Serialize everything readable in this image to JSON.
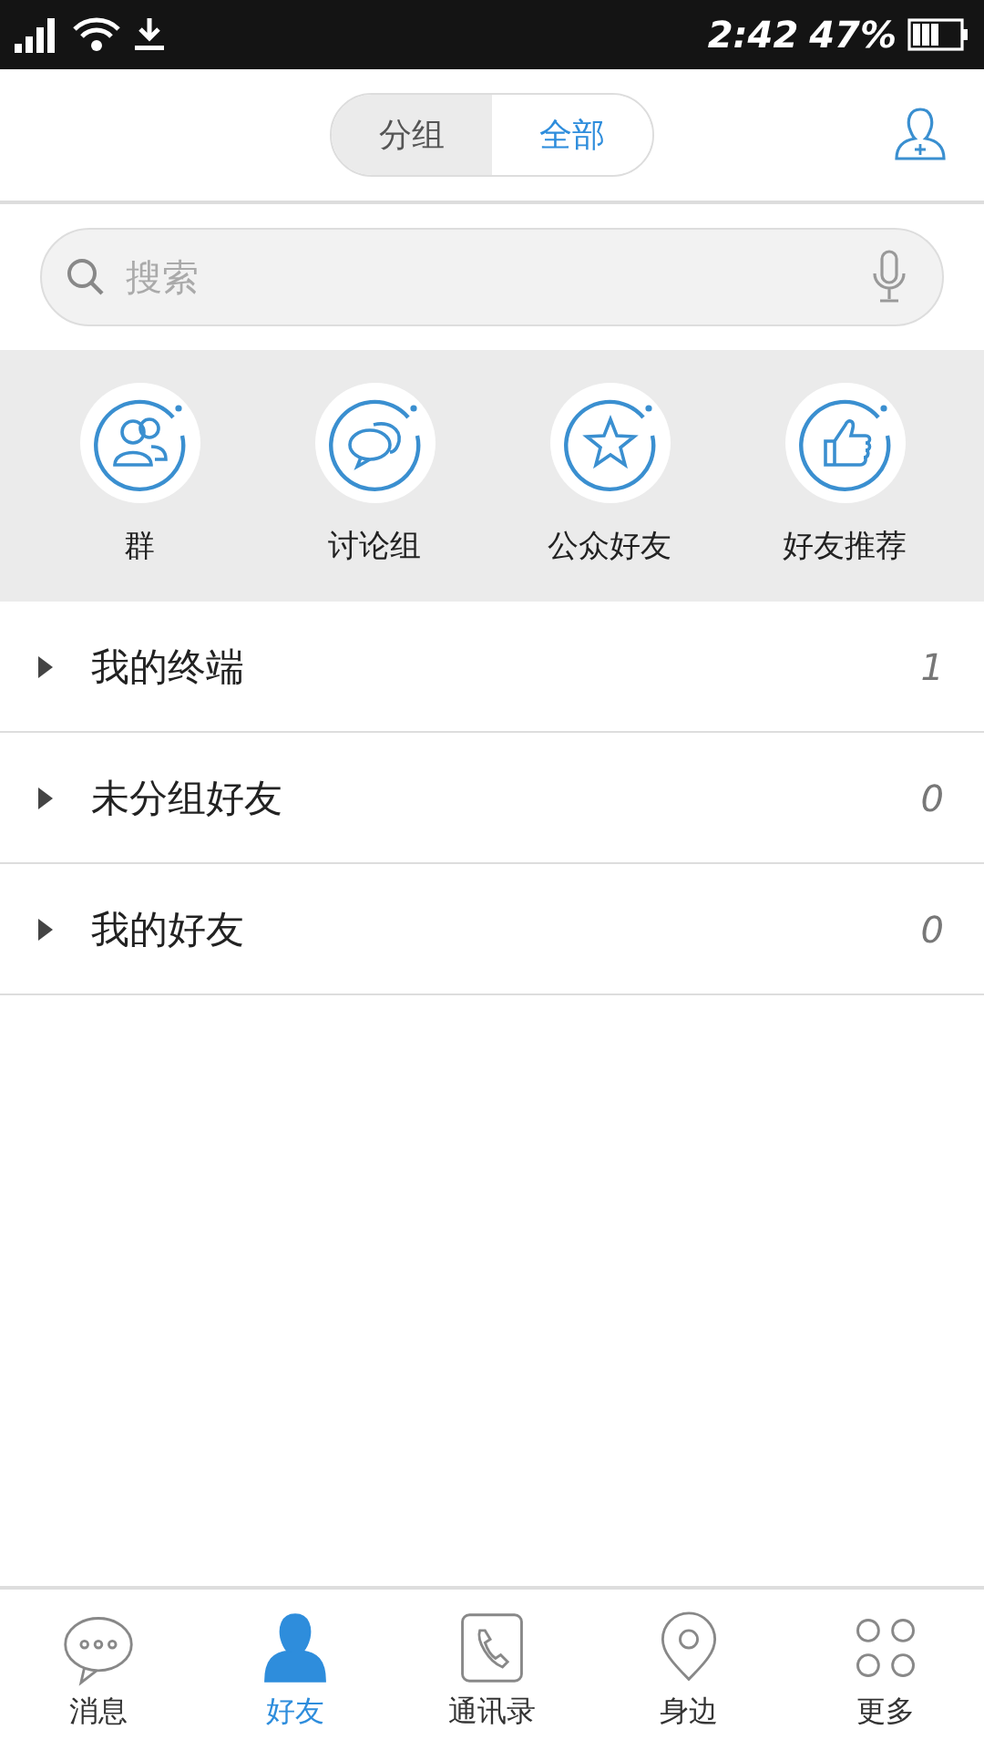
{
  "status_bar": {
    "time": "2:42",
    "battery": "47%"
  },
  "tabs": [
    {
      "label": "分组",
      "selected": false
    },
    {
      "label": "全部",
      "selected": true
    }
  ],
  "search": {
    "placeholder": "搜索"
  },
  "quick_actions": [
    {
      "kind": "group",
      "label": "群"
    },
    {
      "kind": "discussion",
      "label": "讨论组"
    },
    {
      "kind": "star",
      "label": "公众好友"
    },
    {
      "kind": "thumb",
      "label": "好友推荐"
    }
  ],
  "friend_groups": [
    {
      "name": "我的终端",
      "count": "1",
      "expanded": false
    },
    {
      "name": "未分组好友",
      "count": "0",
      "expanded": false
    },
    {
      "name": "我的好友",
      "count": "0",
      "expanded": false
    }
  ],
  "bottom_nav": [
    {
      "kind": "chat",
      "label": "消息",
      "selected": false
    },
    {
      "kind": "person",
      "label": "好友",
      "selected": true
    },
    {
      "kind": "phone",
      "label": "通讯录",
      "selected": false
    },
    {
      "kind": "location",
      "label": "身边",
      "selected": false
    },
    {
      "kind": "more",
      "label": "更多",
      "selected": false
    }
  ]
}
